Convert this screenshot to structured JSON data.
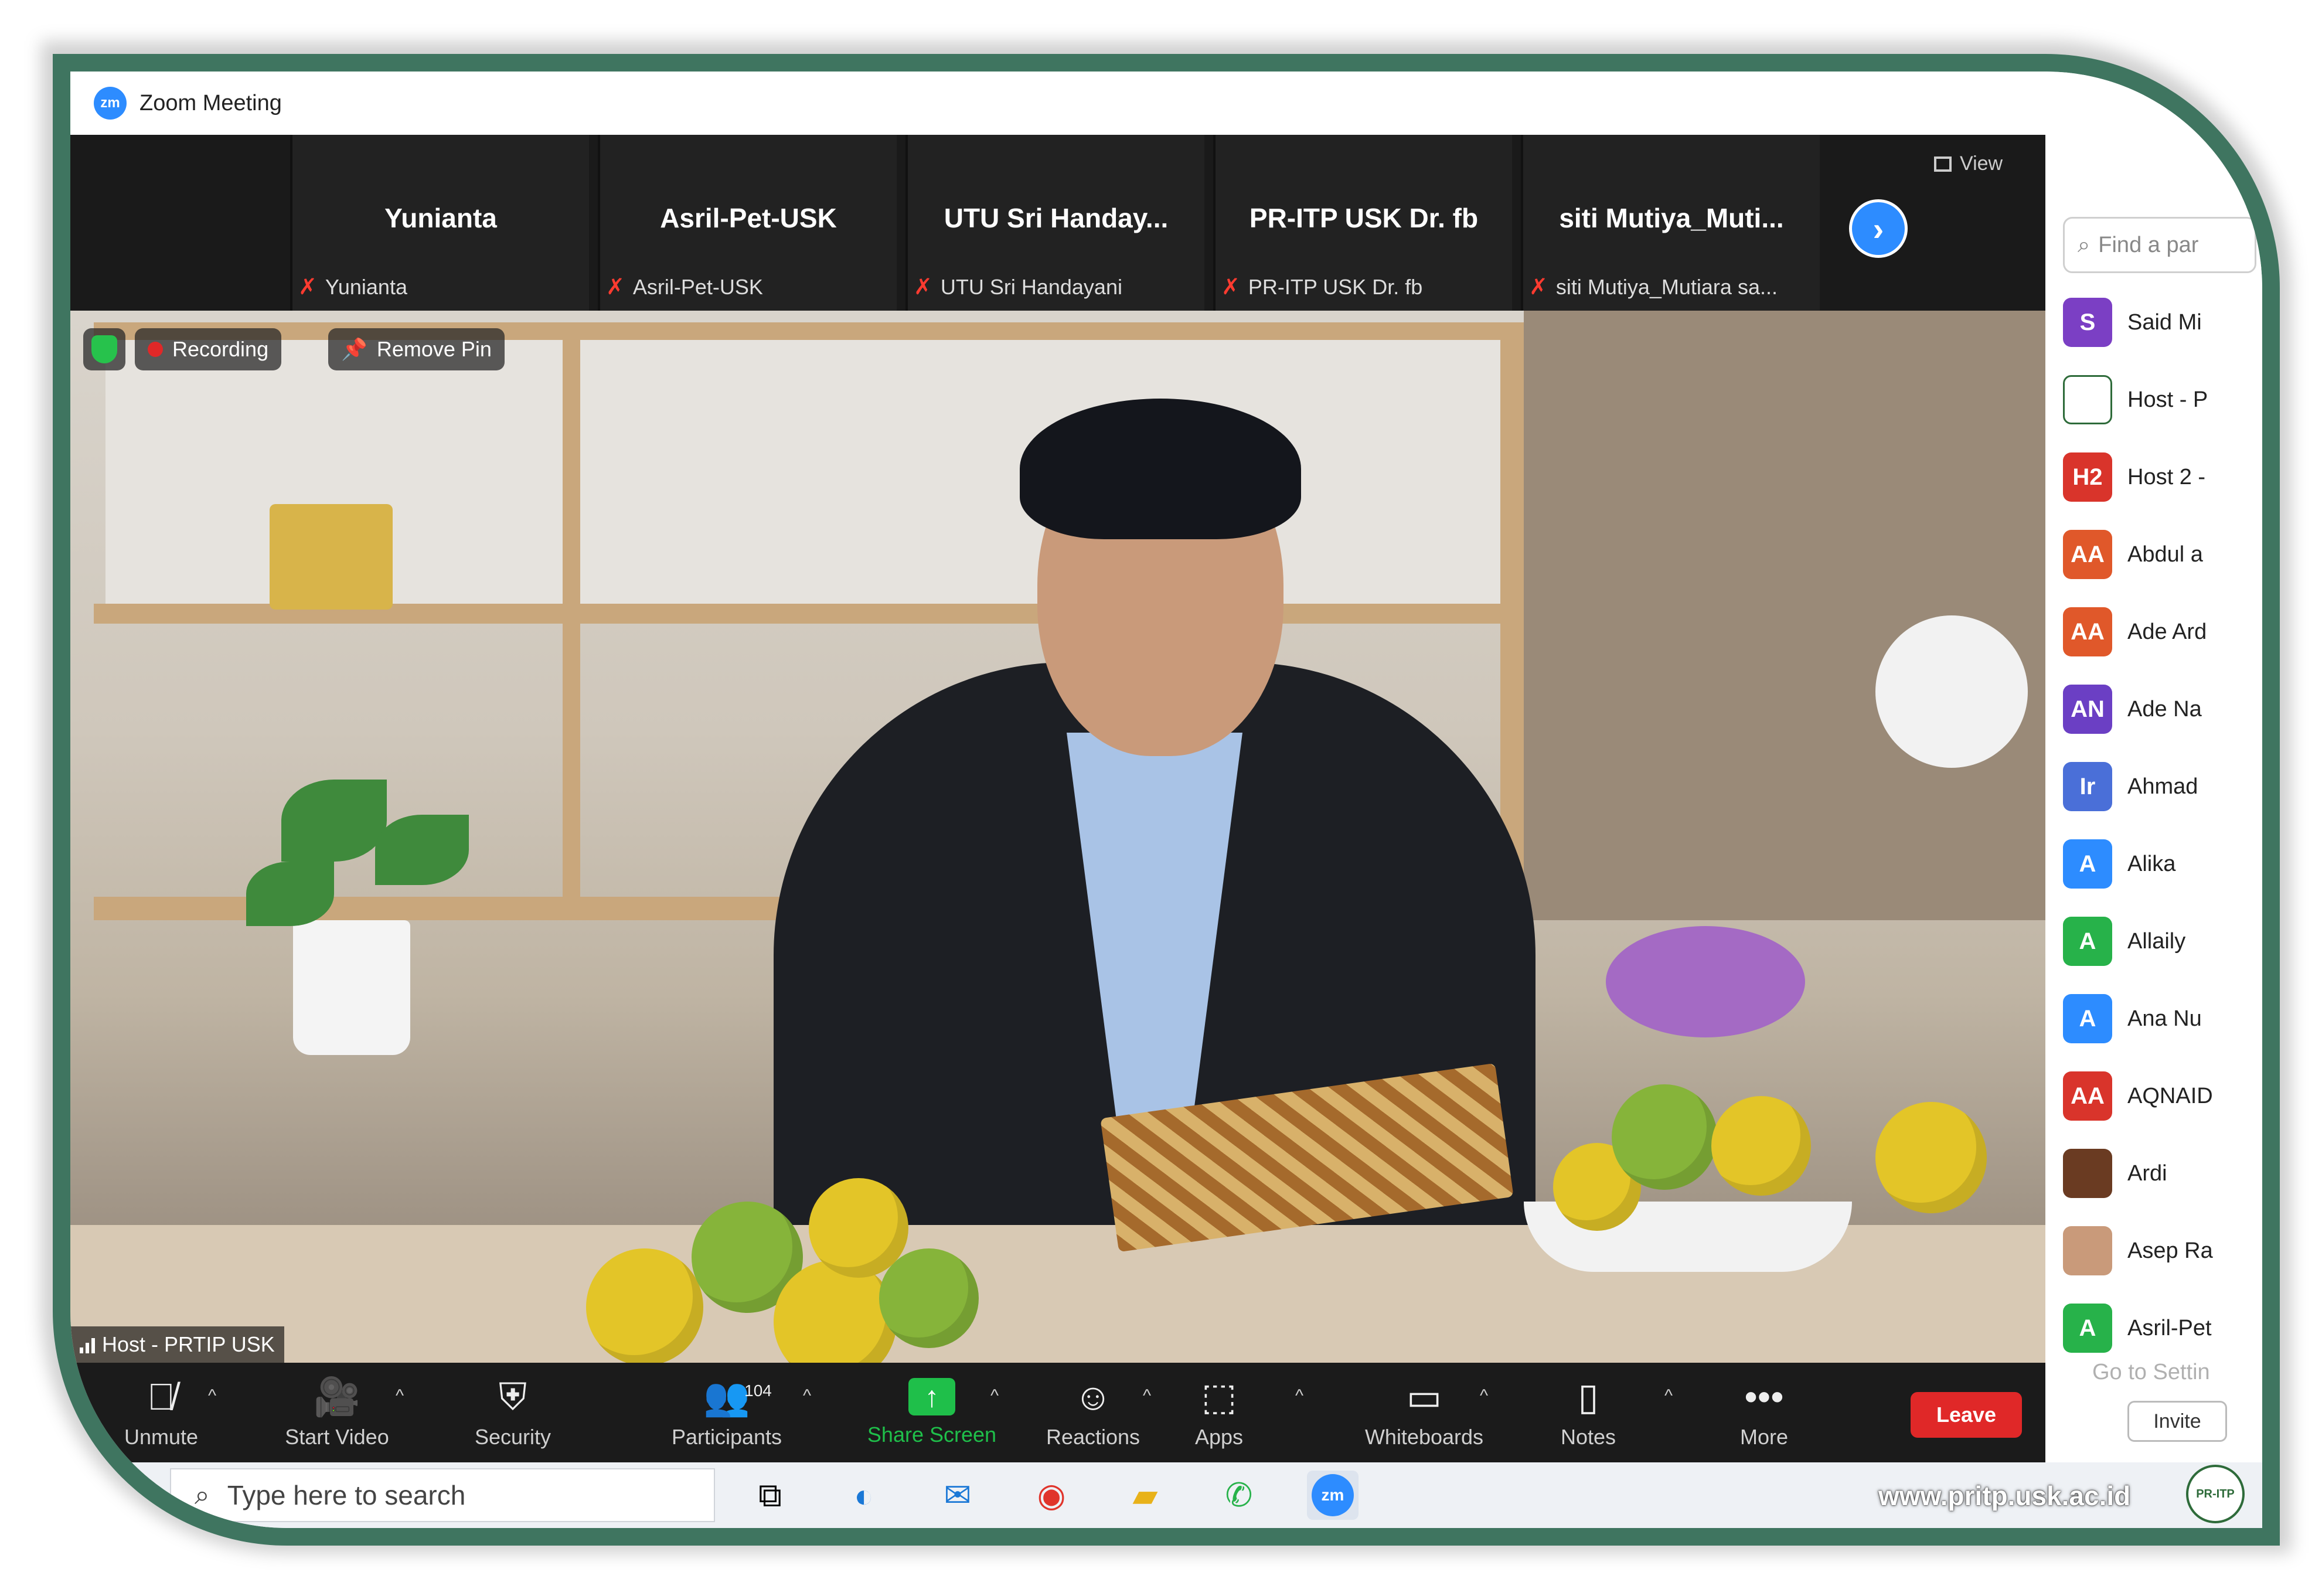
{
  "window": {
    "title": "Zoom Meeting"
  },
  "gallery": {
    "tiles": [
      {
        "name": "Yunianta",
        "label": "Yunianta"
      },
      {
        "name": "Asril-Pet-USK",
        "label": "Asril-Pet-USK"
      },
      {
        "name": "UTU Sri Handay...",
        "label": "UTU Sri Handayani"
      },
      {
        "name": "PR-ITP USK Dr. fb",
        "label": "PR-ITP USK Dr. fb"
      },
      {
        "name": "siti Mutiya_Muti...",
        "label": "siti Mutiya_Mutiara sa..."
      }
    ],
    "view_label": "View"
  },
  "video": {
    "recording_label": "Recording",
    "remove_pin_label": "Remove Pin",
    "speaker_name": "Host - PRTIP USK"
  },
  "toolbar": {
    "unmute": "Unmute",
    "start_video": "Start Video",
    "security": "Security",
    "participants": "Participants",
    "participants_count": "104",
    "share_screen": "Share Screen",
    "reactions": "Reactions",
    "apps": "Apps",
    "whiteboards": "Whiteboards",
    "notes": "Notes",
    "more": "More",
    "leave": "Leave"
  },
  "participants_panel": {
    "search_placeholder": "Find a par",
    "items": [
      {
        "initials": "S",
        "name": "Said Mi",
        "color": "#7b3fc4"
      },
      {
        "initials": "",
        "name": "Host - P",
        "color": "#ffffff"
      },
      {
        "initials": "H2",
        "name": "Host 2 -",
        "color": "#d9342b"
      },
      {
        "initials": "AA",
        "name": "Abdul a",
        "color": "#e0582a"
      },
      {
        "initials": "AA",
        "name": "Ade Ard",
        "color": "#e0582a"
      },
      {
        "initials": "AN",
        "name": "Ade Na",
        "color": "#6b3fc4"
      },
      {
        "initials": "Ir",
        "name": "Ahmad",
        "color": "#4a6fd8"
      },
      {
        "initials": "A",
        "name": "Alika",
        "color": "#2d8cff"
      },
      {
        "initials": "A",
        "name": "Allaily",
        "color": "#27b24a"
      },
      {
        "initials": "A",
        "name": "Ana Nu",
        "color": "#2d8cff"
      },
      {
        "initials": "AA",
        "name": "AQNAID",
        "color": "#d9342b"
      },
      {
        "initials": "",
        "name": "Ardi",
        "color": "#6a3b22"
      },
      {
        "initials": "",
        "name": "Asep Ra",
        "color": "#c99a7a"
      },
      {
        "initials": "A",
        "name": "Asril-Pet",
        "color": "#27b24a"
      }
    ],
    "settings_hint": "Go to Settin",
    "invite": "Invite"
  },
  "taskbar": {
    "search_placeholder": "Type here to search",
    "zoom_app_label": "zm"
  },
  "watermark": "www.pritp.usk.ac.id",
  "seal_text": "PR-ITP"
}
